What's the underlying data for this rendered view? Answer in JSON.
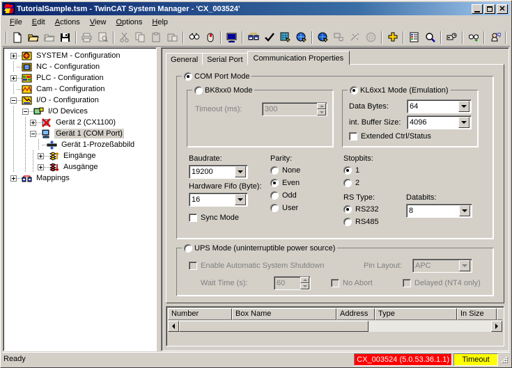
{
  "window": {
    "title": "TutorialSample.tsm - TwinCAT System Manager - 'CX_003524'",
    "icon": "twincat-icon",
    "minimize_label": "",
    "maximize_label": "",
    "close_label": "✕"
  },
  "menubar": {
    "items": [
      {
        "label": "File",
        "accel": "F"
      },
      {
        "label": "Edit",
        "accel": "E"
      },
      {
        "label": "Actions",
        "accel": "A"
      },
      {
        "label": "View",
        "accel": "V"
      },
      {
        "label": "Options",
        "accel": "O"
      },
      {
        "label": "Help",
        "accel": "H"
      }
    ]
  },
  "toolbar": {
    "buttons": [
      {
        "name": "new-icon",
        "enabled": true
      },
      {
        "name": "open-icon",
        "enabled": true
      },
      {
        "name": "open-alt-icon",
        "enabled": false
      },
      {
        "name": "save-icon",
        "enabled": true
      },
      {
        "sep": true
      },
      {
        "name": "print-icon",
        "enabled": false
      },
      {
        "name": "print-preview-icon",
        "enabled": false
      },
      {
        "sep": true
      },
      {
        "name": "cut-icon",
        "enabled": false
      },
      {
        "name": "copy-icon",
        "enabled": false
      },
      {
        "name": "paste-icon",
        "enabled": false
      },
      {
        "name": "paste-special-icon",
        "enabled": false
      },
      {
        "sep": true
      },
      {
        "name": "find-icon",
        "enabled": true
      },
      {
        "name": "mouse-select-icon",
        "enabled": true
      },
      {
        "sep": true
      },
      {
        "name": "choose-target-system-icon",
        "enabled": true
      },
      {
        "sep": true
      },
      {
        "name": "mappings-icon",
        "enabled": true
      },
      {
        "name": "check-config-icon",
        "enabled": true
      },
      {
        "name": "activate-config-icon",
        "enabled": true
      },
      {
        "name": "restart-run-icon",
        "enabled": true
      },
      {
        "sep": true
      },
      {
        "name": "restart-config-icon",
        "enabled": true
      },
      {
        "name": "scan-devices-icon",
        "enabled": false
      },
      {
        "name": "free-run-icon",
        "enabled": false
      },
      {
        "name": "toggle-state-icon",
        "enabled": false
      },
      {
        "sep": true
      },
      {
        "name": "add-box-icon",
        "enabled": true
      },
      {
        "sep": true
      },
      {
        "name": "show-properties-icon",
        "enabled": true
      },
      {
        "name": "zoom-icon",
        "enabled": true
      },
      {
        "sep": true
      },
      {
        "name": "online-link-icon",
        "enabled": true
      },
      {
        "sep": true
      },
      {
        "name": "watch-icon",
        "enabled": true
      },
      {
        "sep": true
      },
      {
        "name": "eventlogger-icon",
        "enabled": true
      },
      {
        "sep": true
      },
      {
        "name": "scope-icon",
        "enabled": true
      },
      {
        "sep": true
      },
      {
        "name": "about-icon",
        "enabled": true
      }
    ]
  },
  "tree": {
    "nodes": [
      {
        "label": "SYSTEM - Configuration",
        "depth": 0,
        "expander": "plus",
        "icon": "system-config-icon",
        "selected": false
      },
      {
        "label": "NC - Configuration",
        "depth": 0,
        "expander": "none",
        "icon": "nc-config-icon",
        "selected": false
      },
      {
        "label": "PLC - Configuration",
        "depth": 0,
        "expander": "plus",
        "icon": "plc-config-icon",
        "selected": false
      },
      {
        "label": "Cam - Configuration",
        "depth": 0,
        "expander": "none",
        "icon": "cam-config-icon",
        "selected": false
      },
      {
        "label": "I/O - Configuration",
        "depth": 0,
        "expander": "minus",
        "icon": "io-config-icon",
        "selected": false
      },
      {
        "label": "I/O Devices",
        "depth": 1,
        "expander": "minus",
        "icon": "io-devices-icon",
        "selected": false
      },
      {
        "label": "Gerät 2 (CX1100)",
        "depth": 2,
        "expander": "plus",
        "icon": "device-disabled-icon",
        "selected": false
      },
      {
        "label": "Gerät 1 (COM Port)",
        "depth": 2,
        "expander": "minus",
        "icon": "device-comport-icon",
        "selected": true
      },
      {
        "label": "Gerät 1-Prozeßabbild",
        "depth": 3,
        "expander": "none",
        "icon": "process-image-icon",
        "selected": false
      },
      {
        "label": "Eingänge",
        "depth": 3,
        "expander": "plus",
        "icon": "inputs-icon",
        "selected": false
      },
      {
        "label": "Ausgänge",
        "depth": 3,
        "expander": "plus",
        "icon": "outputs-icon",
        "selected": false
      },
      {
        "label": "Mappings",
        "depth": 1,
        "expander": "plus",
        "icon": "mappings-icon",
        "selected": false
      }
    ]
  },
  "tabs": [
    {
      "label": "General",
      "active": false
    },
    {
      "label": "Serial Port",
      "active": false
    },
    {
      "label": "Communication Properties",
      "active": true
    }
  ],
  "form": {
    "com_port_mode": {
      "legend": "COM Port Mode",
      "selected": true,
      "bk8xx0": {
        "legend": "BK8xx0 Mode",
        "selected": false,
        "enabled": false,
        "timeout_label": "Timeout (ms):",
        "timeout_value": "300"
      },
      "kl6xx1": {
        "legend": "KL6xx1 Mode (Emulation)",
        "selected": true,
        "enabled": true,
        "data_bytes_label": "Data Bytes:",
        "data_bytes_value": "64",
        "buffer_size_label": "int. Buffer Size:",
        "buffer_size_value": "4096",
        "extended_label": "Extended Ctrl/Status",
        "extended_checked": false
      },
      "baudrate_label": "Baudrate:",
      "baudrate_value": "19200",
      "fifo_label": "Hardware Fifo (Byte):",
      "fifo_value": "16",
      "sync_mode_label": "Sync Mode",
      "sync_mode_checked": false,
      "parity_label": "Parity:",
      "parity_options": [
        {
          "label": "None",
          "selected": false
        },
        {
          "label": "Even",
          "selected": true
        },
        {
          "label": "Odd",
          "selected": false
        },
        {
          "label": "User",
          "selected": false
        }
      ],
      "stopbits_label": "Stopbits:",
      "stopbits_options": [
        {
          "label": "1",
          "selected": true
        },
        {
          "label": "2",
          "selected": false
        }
      ],
      "rstype_label": "RS Type:",
      "rstype_options": [
        {
          "label": "RS232",
          "selected": true
        },
        {
          "label": "RS485",
          "selected": false
        }
      ],
      "databits_label": "Databits:",
      "databits_value": "8"
    },
    "ups_mode": {
      "legend": "UPS Mode (uninterruptible power source)",
      "selected": false,
      "enabled": false,
      "enable_shutdown_label": "Enable Automatic System Shutdown",
      "enable_shutdown_checked": false,
      "pin_layout_label": "Pin Layout:",
      "pin_layout_value": "APC",
      "wait_time_label": "Wait Time (s):",
      "wait_time_value": "60",
      "no_abort_label": "No Abort",
      "no_abort_checked": false,
      "delayed_label": "Delayed (NT4 only)",
      "delayed_checked": false
    }
  },
  "boxlist": {
    "columns": [
      {
        "label": "Number",
        "width": 92
      },
      {
        "label": "Box Name",
        "width": 150
      },
      {
        "label": "Address",
        "width": 55
      },
      {
        "label": "Type",
        "width": 118
      },
      {
        "label": "In Size",
        "width": 57
      },
      {
        "label": "",
        "width": 14
      }
    ]
  },
  "statusbar": {
    "ready_text": "Ready",
    "route": "CX_003524 (5.0.53.36.1.1)",
    "state": "Timeout",
    "route_color": "#ff0000",
    "state_color": "#ffff00"
  },
  "colors": {
    "face": "#d4d0c8",
    "title_active": "#0a246a",
    "window": "#ffffff",
    "shadow": "#808080"
  }
}
